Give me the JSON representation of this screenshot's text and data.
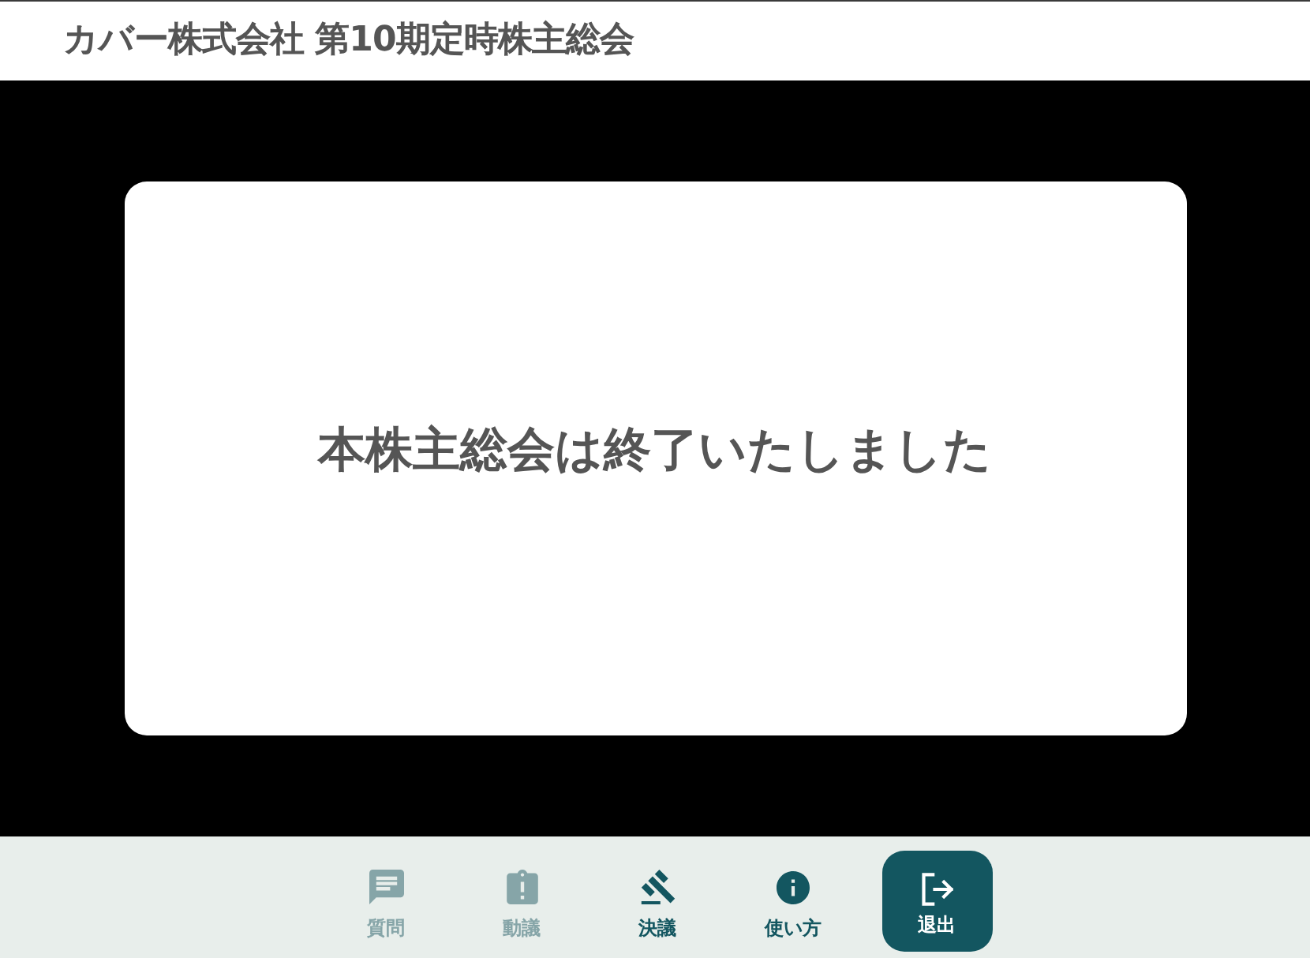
{
  "header": {
    "title": "カバー株式会社 第10期定時株主総会"
  },
  "stage": {
    "message": "本株主総会は終了いたしました"
  },
  "nav": [
    {
      "label": "質問",
      "kind": "tab",
      "disabled": true
    },
    {
      "label": "動議",
      "kind": "tab",
      "disabled": true
    },
    {
      "label": "決議",
      "kind": "tab",
      "disabled": false
    },
    {
      "label": "使い方",
      "kind": "tab",
      "disabled": false
    },
    {
      "label": "退出",
      "kind": "primary",
      "disabled": false
    }
  ]
}
